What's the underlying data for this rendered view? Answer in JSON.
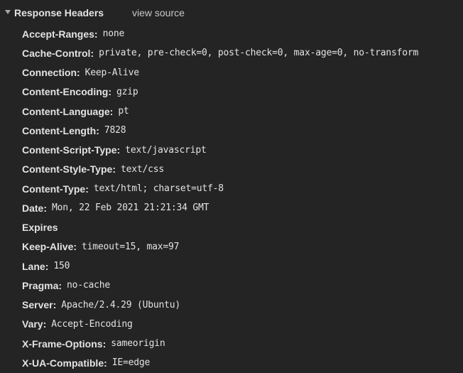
{
  "section": {
    "title": "Response Headers",
    "view_source_label": "view source",
    "toggle_icon": "triangle-down-icon"
  },
  "headers": [
    {
      "name": "Accept-Ranges",
      "value": "none"
    },
    {
      "name": "Cache-Control",
      "value": "private, pre-check=0, post-check=0, max-age=0, no-transform"
    },
    {
      "name": "Connection",
      "value": "Keep-Alive"
    },
    {
      "name": "Content-Encoding",
      "value": "gzip"
    },
    {
      "name": "Content-Language",
      "value": "pt"
    },
    {
      "name": "Content-Length",
      "value": "7828"
    },
    {
      "name": "Content-Script-Type",
      "value": "text/javascript"
    },
    {
      "name": "Content-Style-Type",
      "value": "text/css"
    },
    {
      "name": "Content-Type",
      "value": "text/html; charset=utf-8"
    },
    {
      "name": "Date",
      "value": "Mon, 22 Feb 2021 21:21:34 GMT"
    },
    {
      "name": "Expires",
      "value": ""
    },
    {
      "name": "Keep-Alive",
      "value": "timeout=15, max=97"
    },
    {
      "name": "Lane",
      "value": "150"
    },
    {
      "name": "Pragma",
      "value": "no-cache"
    },
    {
      "name": "Server",
      "value": "Apache/2.4.29 (Ubuntu)"
    },
    {
      "name": "Vary",
      "value": "Accept-Encoding"
    },
    {
      "name": "X-Frame-Options",
      "value": "sameorigin"
    },
    {
      "name": "X-UA-Compatible",
      "value": "IE=edge"
    }
  ],
  "colors": {
    "background": "#242424",
    "text": "#e3e3e3",
    "link": "#c8c8c8",
    "icon": "#a8a8a8"
  }
}
